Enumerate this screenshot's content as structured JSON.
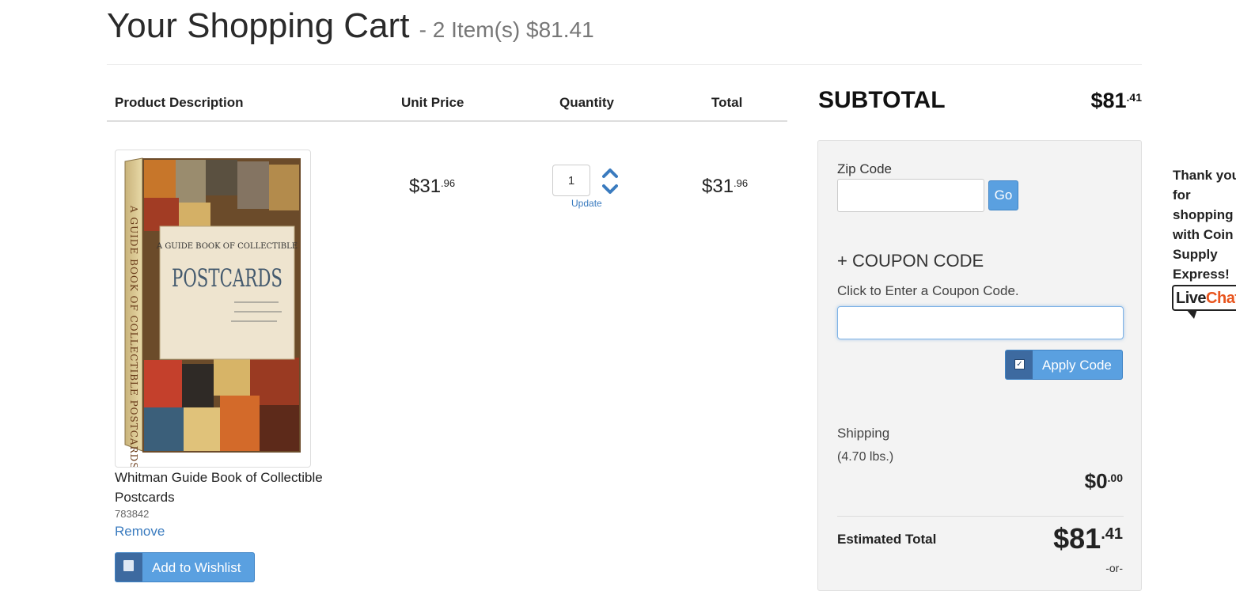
{
  "header": {
    "title": "Your Shopping Cart",
    "summary": "- 2 Item(s) $81.41"
  },
  "table": {
    "columns": [
      "Product Description",
      "Unit Price",
      "Quantity",
      "Total"
    ]
  },
  "item": {
    "name": "Whitman Guide Book of Collectible Postcards",
    "sku": "783842",
    "remove_label": "Remove",
    "wishlist_label": "Add to Wishlist",
    "unit_price": {
      "dollars": "$31",
      "cents": ".96"
    },
    "quantity": "1",
    "update_label": "Update",
    "total": {
      "dollars": "$31",
      "cents": ".96"
    },
    "cover": {
      "title_small": "A GUIDE BOOK OF COLLECTIBLE",
      "title_large": "POSTCARDS",
      "spine": "A GUIDE BOOK OF COLLECTIBLE POSTCARDS"
    }
  },
  "summary": {
    "subtotal_label": "SUBTOTAL",
    "subtotal": {
      "dollars": "$81",
      "cents": ".41"
    },
    "zip_label": "Zip Code",
    "go_label": "Go",
    "coupon_toggle": "+ COUPON CODE",
    "coupon_hint": "Click to Enter a Coupon Code.",
    "apply_label": "Apply Code",
    "shipping_label": "Shipping",
    "shipping_weight": "(4.70 lbs.)",
    "shipping": {
      "dollars": "$0",
      "cents": ".00"
    },
    "estimated_label": "Estimated Total",
    "estimated": {
      "dollars": "$81",
      "cents": ".41"
    },
    "or_label": "-or-"
  },
  "side": {
    "thanks": "Thank you for shopping with Coin Supply Express!",
    "livechat_part1": "Live",
    "livechat_part2": "Chat"
  },
  "colors": {
    "accent_button": "#5aa0e0",
    "button_icon_bg": "#3d6aa0",
    "link": "#3a7bbf",
    "livechat_orange": "#e8541d"
  }
}
